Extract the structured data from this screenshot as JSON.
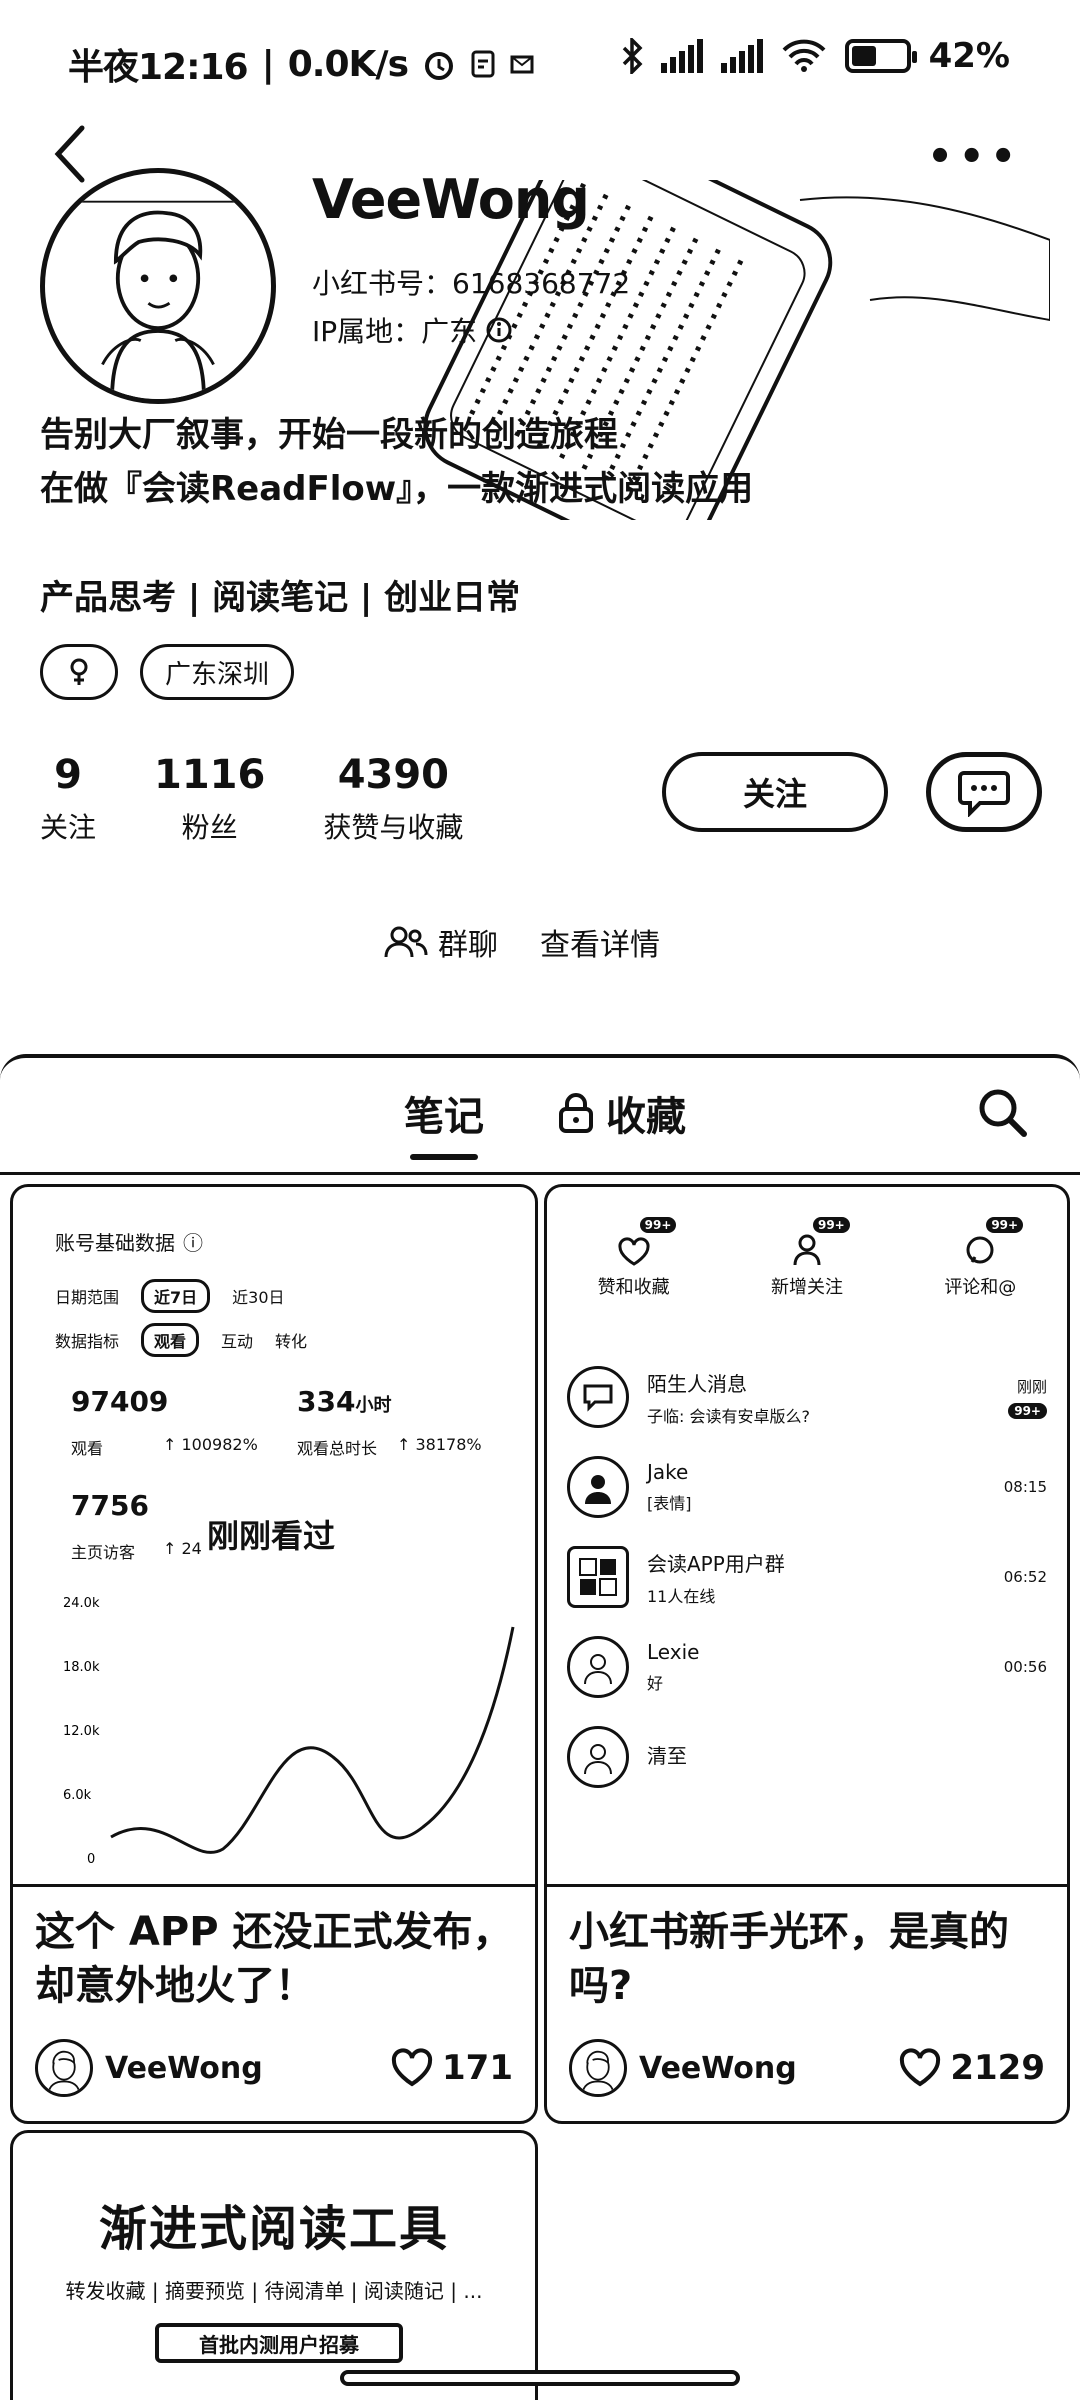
{
  "status_bar": {
    "time": "半夜12:16",
    "speed": "0.0K/s",
    "battery": "42%",
    "battery_level": 0.42
  },
  "profile": {
    "name": "VeeWong",
    "uid_label": "小红书号：",
    "uid": "6168368772",
    "ip_label": "IP属地：广东",
    "bio_line1": "告别大厂叙事，开始一段新的创造旅程",
    "bio_line2": "在做『会读ReadFlow』，一款渐进式阅读应用",
    "tags_line": "产品思考 | 阅读笔记 | 创业日常",
    "chip_location": "广东深圳",
    "stats": [
      {
        "value": "9",
        "label": "关注"
      },
      {
        "value": "1116",
        "label": "粉丝"
      },
      {
        "value": "4390",
        "label": "获赞与收藏"
      }
    ],
    "follow_label": "关注",
    "group_label": "群聊",
    "group_detail": "查看详情"
  },
  "tabs": {
    "notes": "笔记",
    "collections": "收藏"
  },
  "cards": [
    {
      "title": "这个 APP 还没正式发布，却意外地火了！",
      "author": "VeeWong",
      "likes": "171",
      "image": {
        "section_title": "账号基础数据",
        "date_label": "日期范围",
        "date_active": "近7日",
        "date_other": "近30日",
        "metric_label": "数据指标",
        "metric_active": "观看",
        "metric_2": "互动",
        "metric_3": "转化",
        "views": "97409",
        "views_label": "观看",
        "views_growth": "↑ 100982%",
        "time_value": "334",
        "time_unit": "小时",
        "time_label": "观看总时长",
        "time_growth": "↑ 38178%",
        "visits": "7756",
        "visits_label": "主页访客",
        "visits_growth": "↑ 24",
        "overlay": "刚刚看过",
        "chart_ticks": [
          "24.0k",
          "18.0k",
          "12.0k",
          "6.0k",
          "0"
        ]
      }
    },
    {
      "title": "小红书新手光环，是真的吗?",
      "author": "VeeWong",
      "likes": "2129",
      "image": {
        "icons": [
          {
            "label": "赞和收藏",
            "badge": "99+"
          },
          {
            "label": "新增关注",
            "badge": "99+"
          },
          {
            "label": "评论和@",
            "badge": "99+"
          }
        ],
        "messages": [
          {
            "name": "陌生人消息",
            "preview": "子临: 会读有安卓版么?",
            "time": "刚刚",
            "badge": "99+"
          },
          {
            "name": "Jake",
            "preview": "[表情]",
            "time": "08:15"
          },
          {
            "name": "会读APP用户群",
            "preview": "11人在线",
            "time": "06:52"
          },
          {
            "name": "Lexie",
            "preview": "好",
            "time": "00:56"
          },
          {
            "name": "清至",
            "preview": "",
            "time": ""
          }
        ]
      }
    },
    {
      "big_title": "渐进式阅读工具",
      "subtitle": "转发收藏 | 摘要预览 | 待阅清单 | 阅读随记 | ...",
      "button": "首批内测用户招募"
    }
  ]
}
